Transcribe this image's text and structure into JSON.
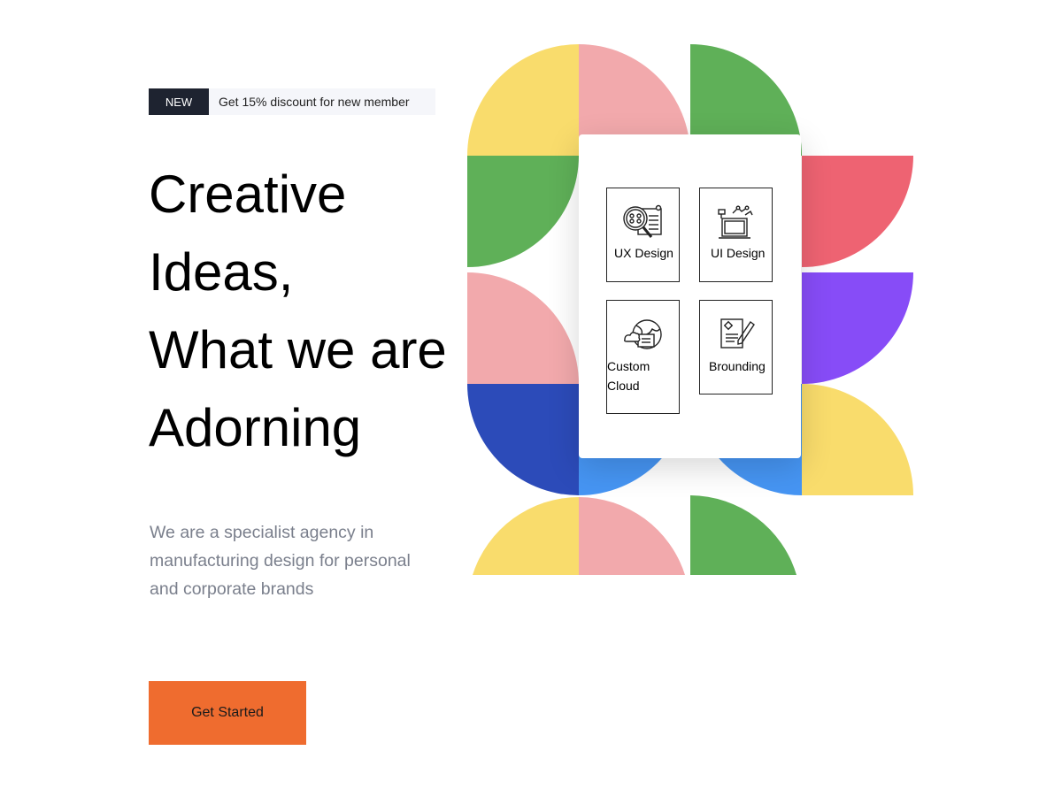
{
  "promo": {
    "badge": "NEW",
    "text": "Get 15% discount for new member"
  },
  "hero": {
    "headline_lines": [
      "Creative",
      "Ideas,",
      "What we are",
      "Adorning"
    ],
    "description": "We are a specialist agency in manufacturing design for personal and corporate brands",
    "cta_label": "Get Started"
  },
  "services": [
    {
      "label": "UX Design",
      "icon": "magnifier-document-icon"
    },
    {
      "label": "UI Design",
      "icon": "monitor-tools-icon"
    },
    {
      "label": "Custom Cloud",
      "icon": "globe-cloud-icon"
    },
    {
      "label": "Brounding",
      "icon": "document-pencil-icon"
    }
  ],
  "colors": {
    "cta": "#ef6c2f",
    "badge": "#1e2330",
    "yellow": "#f9dc6c",
    "pink": "#f2a9ac",
    "green": "#5fb058",
    "red": "#ee6372",
    "purple": "#874cf7",
    "navy": "#2c4bb9",
    "blue": "#4695f3"
  }
}
